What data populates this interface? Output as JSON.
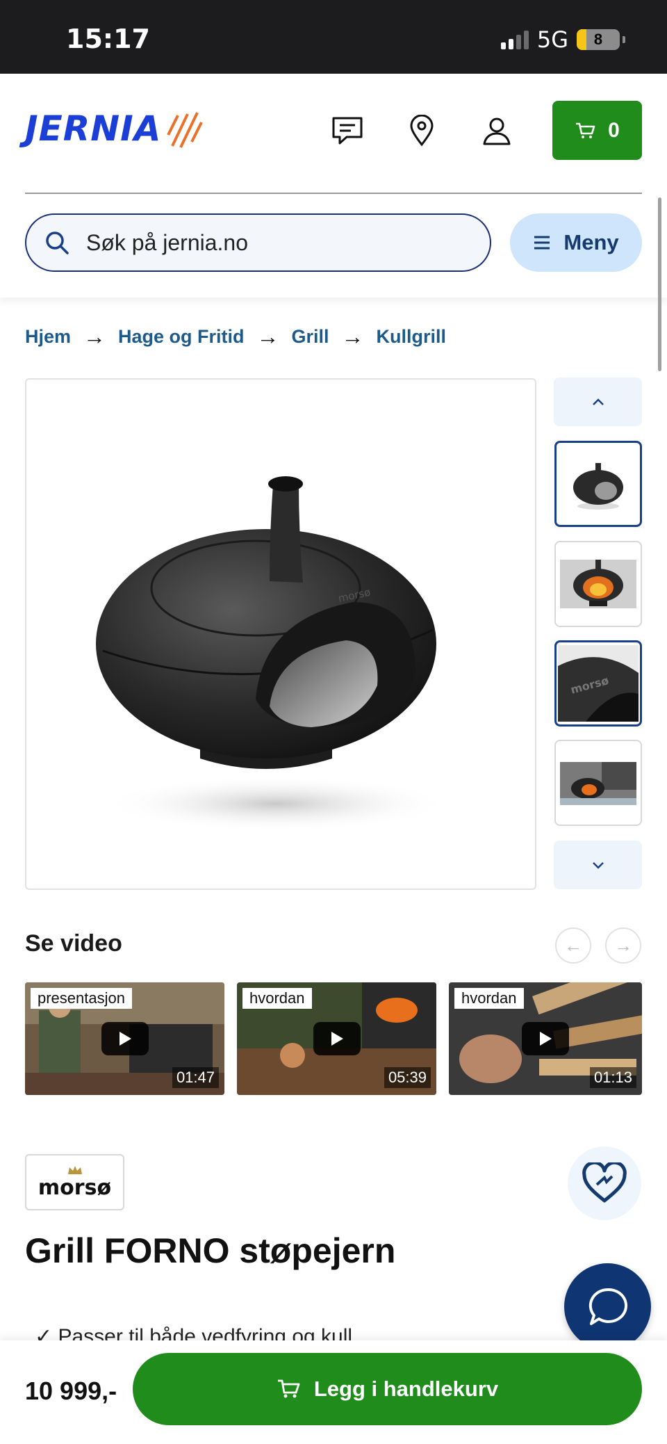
{
  "status_bar": {
    "time": "15:17",
    "network": "5G",
    "battery": "8"
  },
  "header": {
    "logo_text": "JERNIA",
    "cart_count": "0",
    "search_placeholder": "Søk på jernia.no",
    "menu_label": "Meny"
  },
  "breadcrumb": [
    "Hjem",
    "Hage og Fritid",
    "Grill",
    "Kullgrill"
  ],
  "gallery": {
    "main_image": "grill-forno-product",
    "thumbnails": [
      "grill-forno",
      "grill-forno-fire",
      "grill-forno-logo-detail",
      "grill-forno-patio"
    ]
  },
  "videos": {
    "title": "Se video",
    "items": [
      {
        "tag": "presentasjon",
        "duration": "01:47"
      },
      {
        "tag": "hvordan",
        "duration": "05:39"
      },
      {
        "tag": "hvordan",
        "duration": "01:13"
      }
    ]
  },
  "product": {
    "brand": "morsø",
    "title": "Grill FORNO støpejern",
    "feature_partial": "Passer til både vedfyring og kull",
    "price": "10 999,-",
    "add_to_cart_label": "Legg i handlekurv"
  },
  "colors": {
    "brand_blue": "#1b3fd6",
    "cart_green": "#1f8c1c",
    "link_blue": "#1d5a8c",
    "chat_navy": "#0f3572"
  }
}
